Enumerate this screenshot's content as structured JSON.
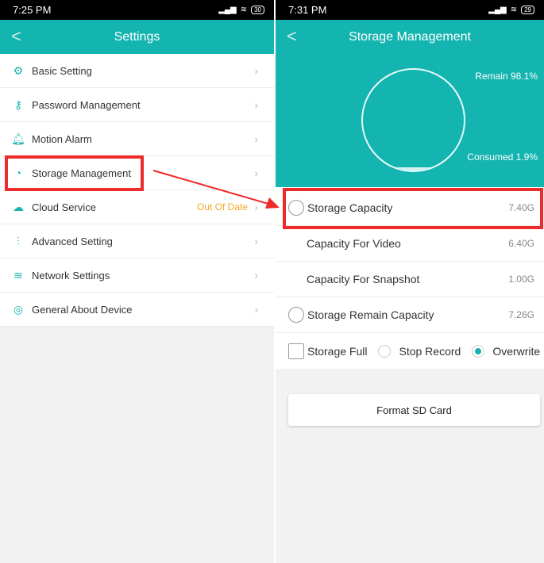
{
  "left": {
    "status_time": "7:25 PM",
    "battery": "30",
    "title": "Settings",
    "items": [
      {
        "label": "Basic Setting",
        "icon": "gear-icon"
      },
      {
        "label": "Password Management",
        "icon": "key-icon"
      },
      {
        "label": "Motion Alarm",
        "icon": "bell-icon"
      },
      {
        "label": "Storage Management",
        "icon": "storage-icon"
      },
      {
        "label": "Cloud Service",
        "icon": "cloud-icon",
        "status": "Out Of Date"
      },
      {
        "label": "Advanced Setting",
        "icon": "sliders-icon"
      },
      {
        "label": "Network Settings",
        "icon": "wifi-icon"
      },
      {
        "label": "General About Device",
        "icon": "info-icon"
      }
    ]
  },
  "right": {
    "status_time": "7:31 PM",
    "battery": "29",
    "title": "Storage Management",
    "remain_label": "Remain 98.1%",
    "consumed_label": "Consumed 1.9%",
    "consumed_fraction": 0.019,
    "rows": [
      {
        "label": "Storage Capacity",
        "value": "7.40G"
      },
      {
        "label": "Capacity For Video",
        "value": "6.40G"
      },
      {
        "label": "Capacity For Snapshot",
        "value": "1.00G"
      },
      {
        "label": "Storage Remain Capacity",
        "value": "7.26G"
      }
    ],
    "storage_full": {
      "label": "Storage Full",
      "options": [
        "Stop Record",
        "Overwrite"
      ],
      "selected": "Overwrite"
    },
    "format_button": "Format SD Card"
  },
  "colors": {
    "accent": "#14b4b0",
    "annotation": "#ee2b2b",
    "warning": "#f5a623"
  }
}
